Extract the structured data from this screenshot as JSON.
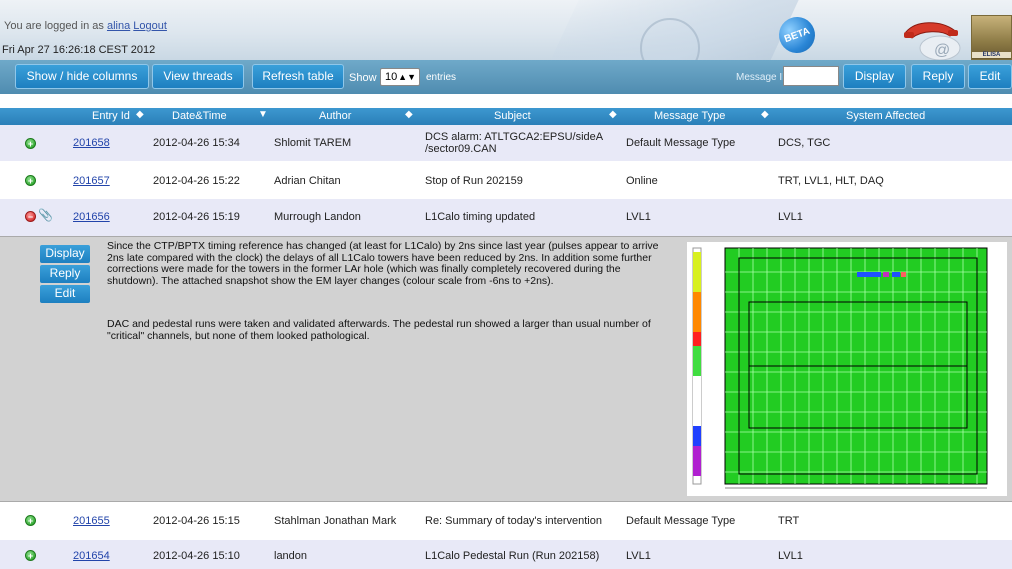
{
  "header": {
    "logged_in_prefix": "You are logged in as",
    "user": "alina",
    "logout": "Logout",
    "datetime": "Fri Apr 27 16:26:18 CEST 2012",
    "beta": "BETA",
    "logo_text": "ELISA"
  },
  "toolbar": {
    "show_hide_columns": "Show / hide columns",
    "view_threads": "View threads",
    "refresh_table": "Refresh table",
    "show_label": "Show",
    "entries_value": "10",
    "entries_label": "entries",
    "message_id_label": "Message ID:",
    "message_id_value": "",
    "display": "Display",
    "reply": "Reply",
    "edit": "Edit"
  },
  "columns": {
    "entry_id": "Entry Id",
    "datetime": "Date&Time",
    "author": "Author",
    "subject": "Subject",
    "message_type": "Message Type",
    "system_affected": "System Affected"
  },
  "rows": [
    {
      "id": "201658",
      "datetime": "2012-04-26 15:34",
      "author": "Shlomit TAREM",
      "subject": "DCS alarm: ATLTGCA2:EPSU/sideA /sector09.CAN",
      "type": "Default Message Type",
      "systems": "DCS, TGC"
    },
    {
      "id": "201657",
      "datetime": "2012-04-26 15:22",
      "author": "Adrian Chitan",
      "subject": "Stop of Run 202159",
      "type": "Online",
      "systems": "TRT, LVL1, HLT, DAQ"
    },
    {
      "id": "201656",
      "datetime": "2012-04-26 15:19",
      "author": "Murrough Landon",
      "subject": "L1Calo timing updated",
      "type": "LVL1",
      "systems": "LVL1"
    },
    {
      "id": "201655",
      "datetime": "2012-04-26 15:15",
      "author": "Stahlman Jonathan Mark",
      "subject": "Re: Summary of today's intervention",
      "type": "Default Message Type",
      "systems": "TRT"
    },
    {
      "id": "201654",
      "datetime": "2012-04-26 15:10",
      "author": "landon",
      "subject": "L1Calo Pedestal Run (Run 202158)",
      "type": "LVL1",
      "systems": "LVL1"
    }
  ],
  "detail": {
    "display": "Display",
    "reply": "Reply",
    "edit": "Edit",
    "para1": "Since the CTP/BPTX timing reference has changed (at least for L1Calo) by 2ns since last year (pulses appear to arrive 2ns late compared with the clock) the delays of all L1Calo towers have been reduced by 2ns. In addition some further corrections were made for the towers in the former LAr hole (which was finally completely recovered during the shutdown). The attached snapshot show the EM layer changes (colour scale from -6ns to +2ns).",
    "para2": "DAC and pedestal runs were taken and validated afterwards. The pedestal run showed a larger than usual number of \"critical\" channels, but none of them looked pathological."
  },
  "colors": {
    "toolbar": "#4f8cb0",
    "button": "#2a8fcf",
    "header_row": "#2a7fb8",
    "row_alt": "#e8e9f7",
    "detail_bg": "#d2d2d2",
    "grid_green": "#22cc22"
  }
}
